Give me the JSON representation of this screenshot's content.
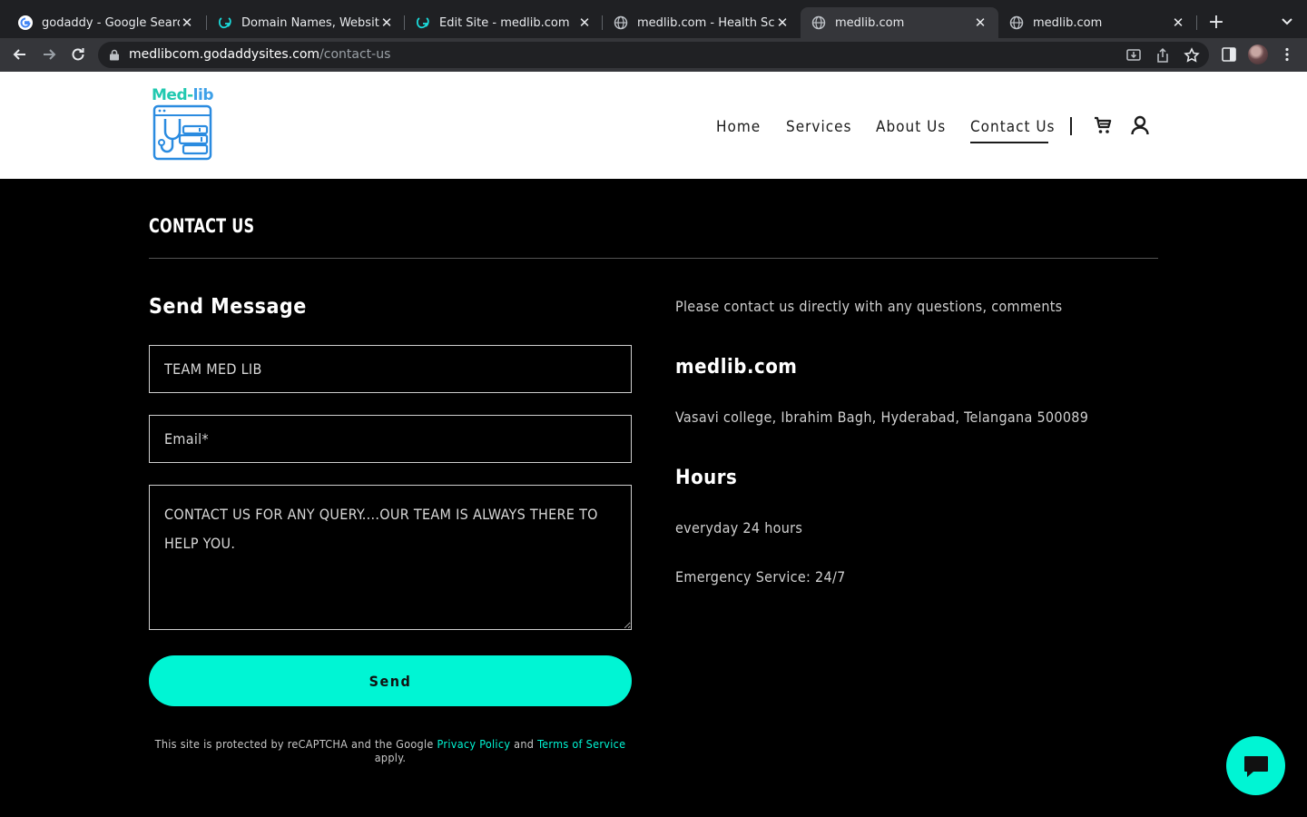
{
  "browser": {
    "tabs": [
      {
        "title": "godaddy - Google Search",
        "icon": "google-icon"
      },
      {
        "title": "Domain Names, Websites, Hosting",
        "icon": "godaddy-icon"
      },
      {
        "title": "Edit Site - medlib.com",
        "icon": "godaddy-icon"
      },
      {
        "title": "medlib.com - Health Schemes",
        "icon": "globe-icon"
      },
      {
        "title": "medlib.com",
        "icon": "globe-icon",
        "active": true
      },
      {
        "title": "medlib.com",
        "icon": "globe-icon"
      }
    ],
    "url_host": "medlibcom.godaddysites.com",
    "url_path": "/contact-us"
  },
  "site": {
    "logo": {
      "part1": "Med-",
      "part2": "lib"
    },
    "nav": {
      "home": "Home",
      "services": "Services",
      "about": "About Us",
      "contact": "Contact Us"
    },
    "page_title": "CONTACT US",
    "form": {
      "title": "Send Message",
      "name_value": "TEAM MED LIB",
      "email_placeholder": "Email*",
      "message_value": "CONTACT US FOR ANY QUERY....OUR TEAM IS ALWAYS THERE TO HELP YOU.",
      "send_label": "Send",
      "recaptcha_prefix": "This site is protected by reCAPTCHA and the Google",
      "privacy_label": "Privacy Policy",
      "and_label": "and",
      "terms_label": "Terms of Service",
      "recaptcha_suffix": "apply."
    },
    "info": {
      "intro": "Please contact us directly with any questions, comments",
      "business_name": "medlib.com",
      "address": "Vasavi college, Ibrahim Bagh, Hyderabad, Telangana 500089",
      "hours_title": "Hours",
      "hours": "everyday 24 hours",
      "emergency": "Emergency Service: 24/7"
    }
  },
  "colors": {
    "accent": "#00f5d4",
    "page_bg": "#000000",
    "header_bg": "#ffffff"
  }
}
